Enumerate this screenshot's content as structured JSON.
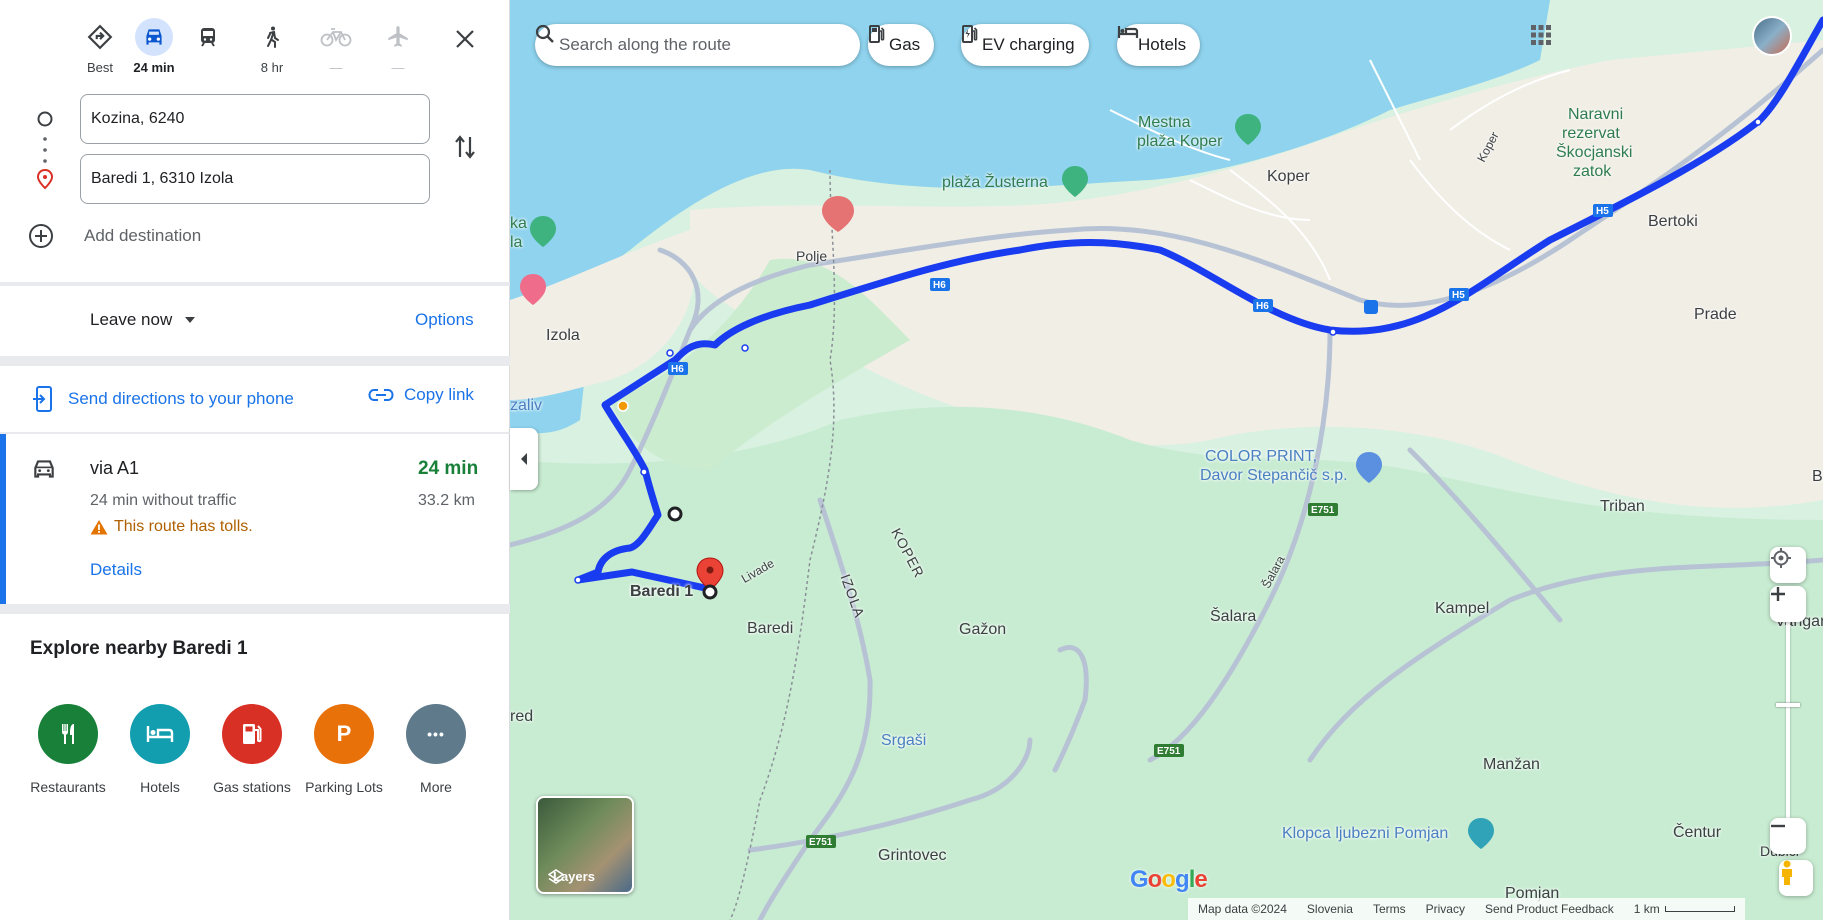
{
  "modes": [
    {
      "name": "Best",
      "label": "Best"
    },
    {
      "name": "Driving",
      "label": "24 min"
    },
    {
      "name": "Transit",
      "label": ""
    },
    {
      "name": "Walking",
      "label": "8 hr"
    },
    {
      "name": "Cycling",
      "label": "—"
    },
    {
      "name": "Flights",
      "label": "—"
    }
  ],
  "waypoints": {
    "origin": "Kozina, 6240",
    "destination": "Baredi 1, 6310 Izola"
  },
  "add_destination": "Add destination",
  "leave_now": "Leave now",
  "options": "Options",
  "send_directions": "Send directions to your phone",
  "copy_link": "Copy link",
  "route": {
    "via": "via A1",
    "time": "24 min",
    "without_traffic": "24 min without traffic",
    "distance": "33.2 km",
    "warning": "This route has tolls.",
    "details": "Details"
  },
  "explore": {
    "title": "Explore nearby Baredi 1",
    "categories": [
      {
        "label": "Restaurants",
        "color": "#188038",
        "icon": "fork-knife-icon"
      },
      {
        "label": "Hotels",
        "color": "#129eaf",
        "icon": "bed-icon"
      },
      {
        "label": "Gas stations",
        "color": "#d93025",
        "icon": "gas-pump-icon"
      },
      {
        "label": "Parking Lots",
        "color": "#e8710a",
        "icon": "parking-icon",
        "glyph": "P"
      },
      {
        "label": "More",
        "color": "#5f7a8a",
        "icon": "more-icon",
        "glyph": "•••"
      }
    ]
  },
  "map": {
    "search_placeholder": "Search along the route",
    "chips": [
      "Gas",
      "EV charging",
      "Hotels"
    ],
    "layers_label": "Layers",
    "google_logo": "Google",
    "footer": [
      "Map data ©2024",
      "Slovenia",
      "Terms",
      "Privacy",
      "Send Product Feedback",
      "1 km"
    ],
    "labels": {
      "koper": "Koper",
      "izola": "Izola",
      "bertoki": "Bertoki",
      "prade": "Prade",
      "triban": "Triban",
      "kampel": "Kampel",
      "salara": "Šalara",
      "gazon": "Gažon",
      "baredi": "Baredi",
      "baredi1": "Baredi 1",
      "srgasi": "Srgaši",
      "grintovec": "Grintovec",
      "manzan": "Manžan",
      "centur": "Čentur",
      "pomjan": "Pomjan",
      "polje": "Polje",
      "zaliv": "zaliv",
      "red": "red",
      "vangane": "Vangane",
      "dubici": "Dubiči",
      "b": "B",
      "mestna": "Mestna",
      "plaza_koper": "plaža Koper",
      "plaza_zusterna": "plaža Žusterna",
      "naravni": "Naravni",
      "rezervat": "rezervat",
      "skocjanski": "Škocjanski",
      "zatok": "zatok",
      "color_print": "COLOR PRINT,",
      "davor": "Davor Stepančič s.p.",
      "klopca": "Klopca ljubezni Pomjan",
      "ka": "ka",
      "la": "la",
      "izola_border": "IZOLA",
      "koper_border": "KOPER",
      "h6": "H6",
      "h5": "H5",
      "e751": "E751",
      "livade": "Livade",
      "salara_road": "Šalara",
      "koper_road": "Koper"
    }
  },
  "colors": {
    "accent": "#1a73e8",
    "route": "#1a3cf0",
    "water": "#8fd3ee",
    "land": "#d8f1e0"
  }
}
